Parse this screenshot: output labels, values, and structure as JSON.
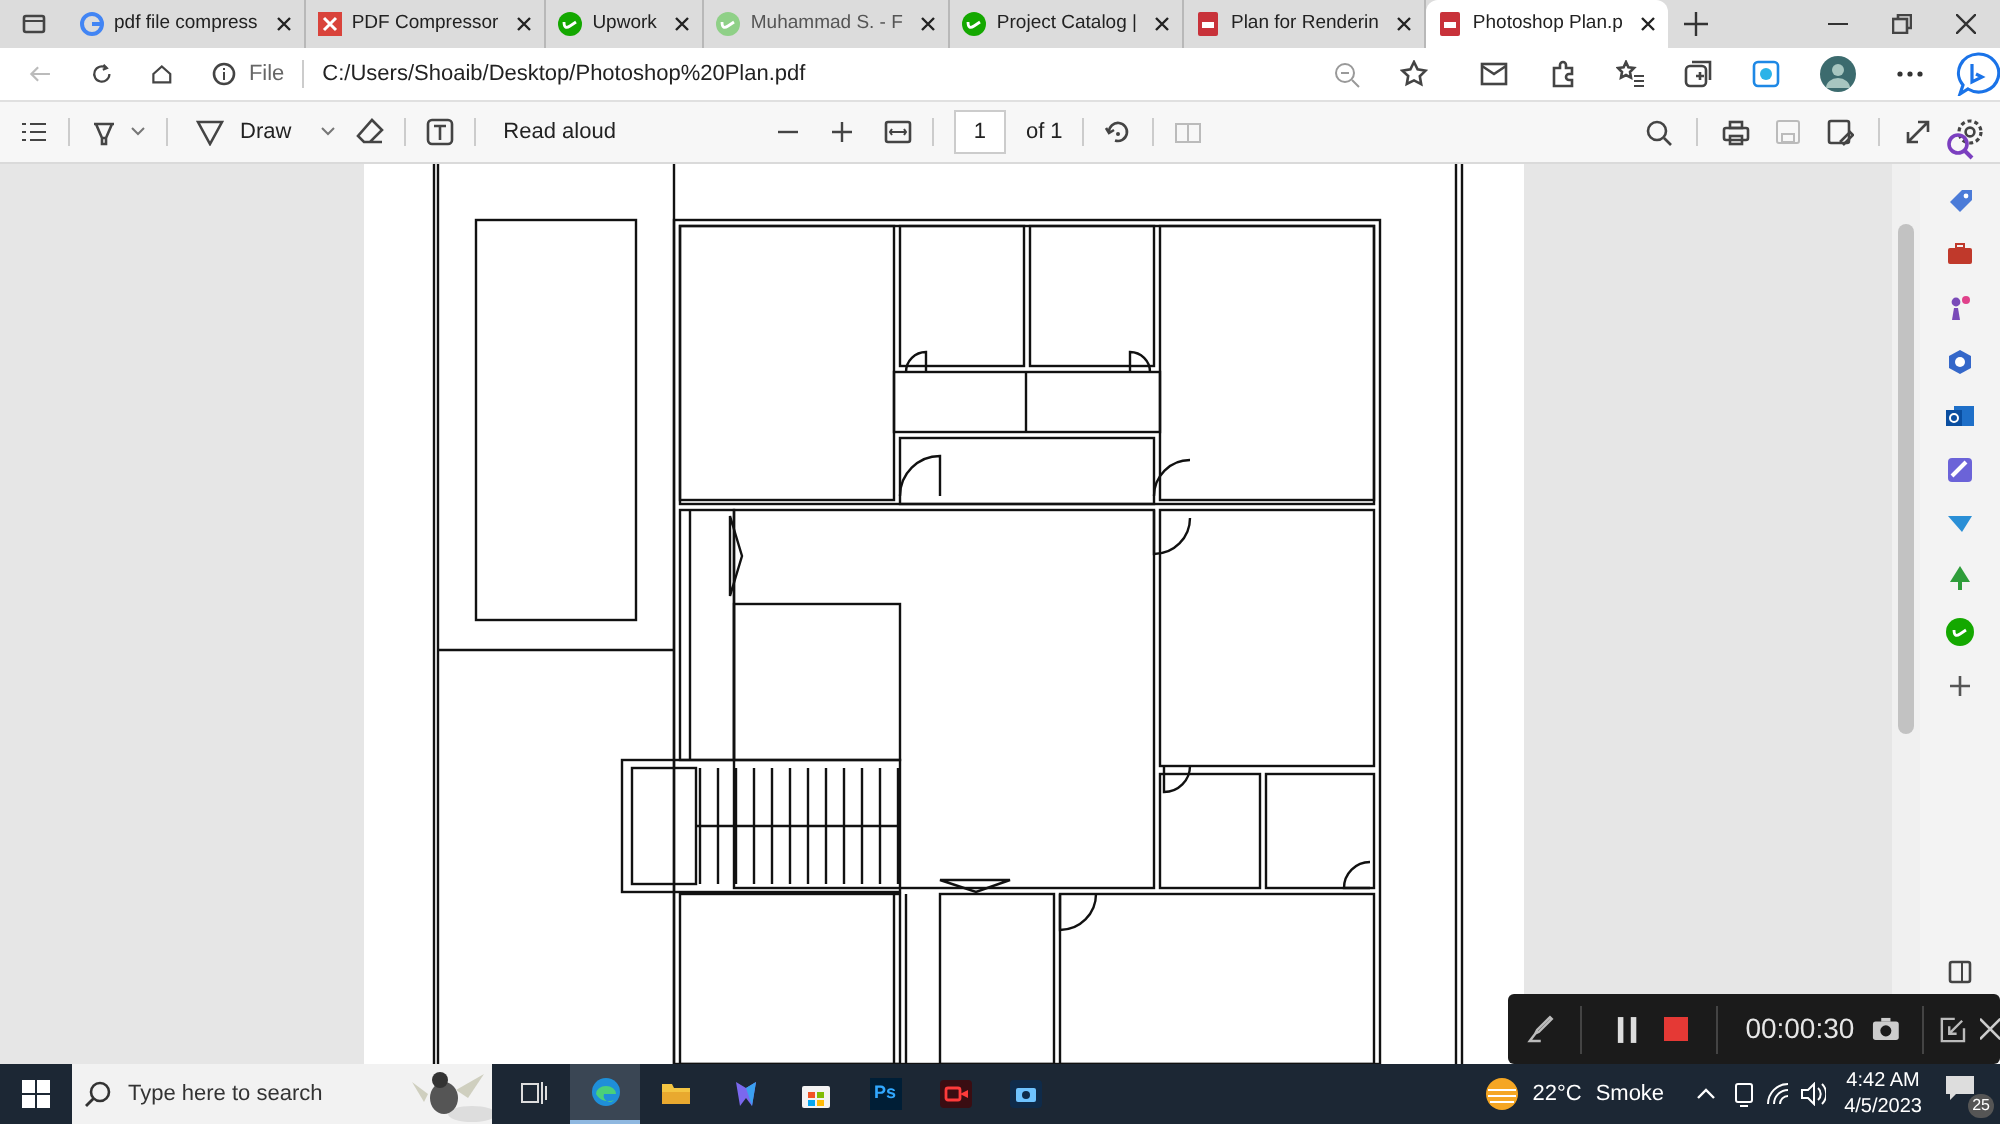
{
  "tabs": [
    {
      "label": "pdf file compress",
      "kind": "google",
      "selected": false
    },
    {
      "label": "PDF Compressor",
      "kind": "compressor",
      "selected": false
    },
    {
      "label": "Upwork",
      "kind": "upwork",
      "selected": false
    },
    {
      "label": "Muhammad S. - F",
      "kind": "upwork-faded",
      "selected": false
    },
    {
      "label": "Project Catalog |",
      "kind": "upwork",
      "selected": false
    },
    {
      "label": "Plan for Renderin",
      "kind": "pdf",
      "selected": false
    },
    {
      "label": "Photoshop Plan.p",
      "kind": "pdf",
      "selected": true
    }
  ],
  "address_bar": {
    "scheme": "File",
    "url": "C:/Users/Shoaib/Desktop/Photoshop%20Plan.pdf"
  },
  "pdf_toolbar": {
    "draw": "Draw",
    "read_aloud": "Read aloud",
    "page": "1",
    "page_count": "of 1"
  },
  "recorder": {
    "time": "00:00:30"
  },
  "taskbar": {
    "search_placeholder": "Type here to search",
    "apps": [
      {
        "kind": "task-view",
        "selected": false
      },
      {
        "kind": "edge",
        "selected": true
      },
      {
        "kind": "folder",
        "selected": false
      },
      {
        "kind": "copilot",
        "selected": false
      },
      {
        "kind": "store",
        "selected": false
      },
      {
        "kind": "photoshop",
        "selected": false
      },
      {
        "kind": "recorder",
        "selected": false
      },
      {
        "kind": "camera",
        "selected": false
      }
    ],
    "photoshop_label": "Ps",
    "temperature": "22°C",
    "weather": "Smoke",
    "time": "4:42 AM",
    "date": "4/5/2023",
    "notifications": "25"
  }
}
